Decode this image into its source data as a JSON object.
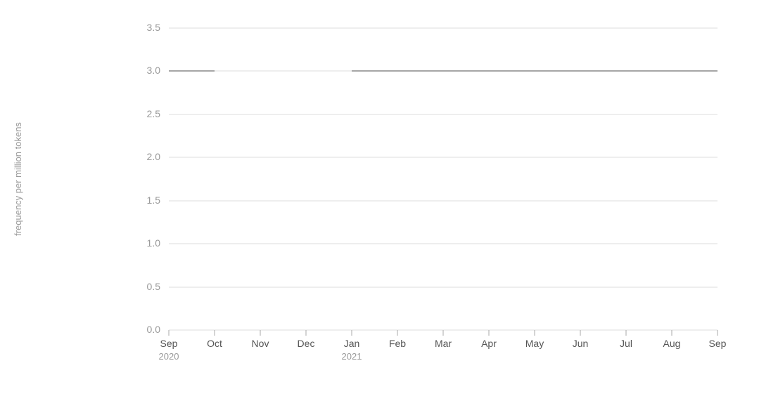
{
  "chart": {
    "title": "",
    "yAxis": {
      "label": "frequency per million tokens",
      "ticks": [
        "3.5",
        "3.0",
        "2.5",
        "2.0",
        "1.5",
        "1.0",
        "0.5",
        "0.0"
      ]
    },
    "xAxis": {
      "labels": [
        "Sep",
        "Oct",
        "Nov",
        "Dec",
        "Jan",
        "Feb",
        "Mar",
        "Apr",
        "May",
        "Jun",
        "Jul",
        "Aug",
        "Sep"
      ],
      "yearLabels": [
        {
          "text": "2020",
          "index": 0
        },
        {
          "text": "2021",
          "index": 4
        }
      ]
    },
    "colors": {
      "gridLine": "#d0d0d0",
      "axisText": "#999999",
      "dataLine": "#888888"
    },
    "series": [
      {
        "points": [
          {
            "x": 0,
            "y": 3.0
          },
          {
            "x": 4,
            "y": 3.0
          }
        ]
      }
    ]
  }
}
